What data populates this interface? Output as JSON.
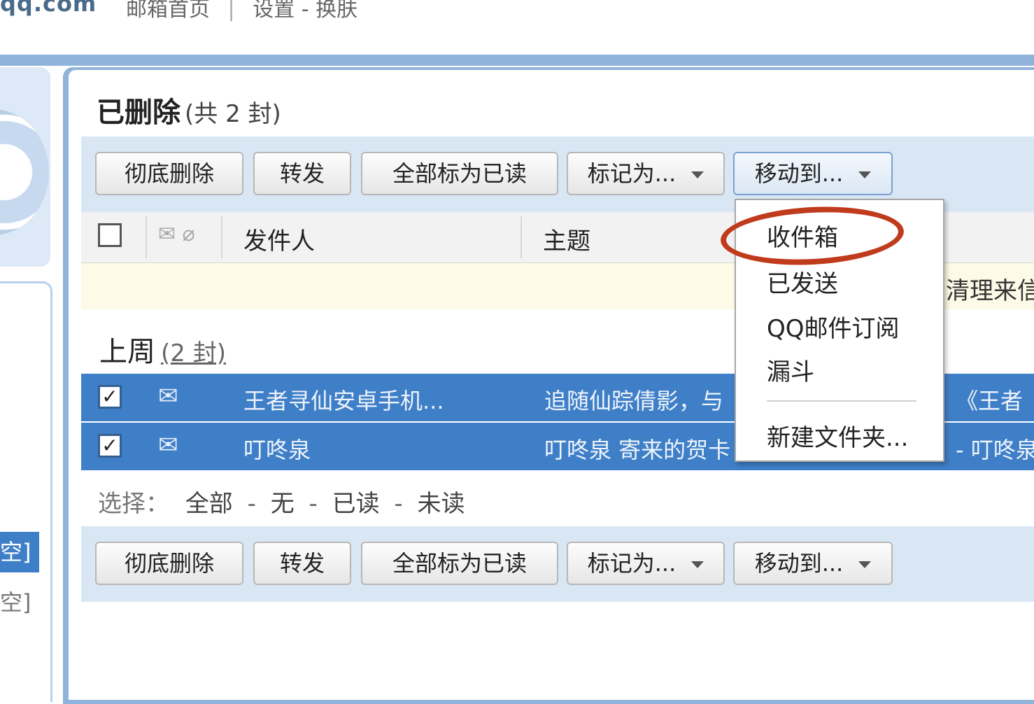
{
  "header": {
    "brand": "qq.com",
    "home_link": "邮箱首页",
    "separator": "|",
    "settings_link": "设置 - 换肤"
  },
  "sidebar": {
    "empty_label_1": "空]",
    "empty_label_2": "空]"
  },
  "folder": {
    "title": "已删除",
    "count": "(共 2 封)"
  },
  "toolbar": {
    "delete_forever": "彻底删除",
    "forward": "转发",
    "mark_all_read": "全部标为已读",
    "mark_as": "标记为...",
    "move_to": "移动到..."
  },
  "list_header": {
    "sender": "发件人",
    "subject": "主题"
  },
  "notice": {
    "text": "清理来信"
  },
  "group": {
    "title": "上周",
    "count": "(2 封)"
  },
  "mails": [
    {
      "sender": "王者寻仙安卓手机...",
      "subject": "追随仙踪倩影，与",
      "extra": "《王者",
      "checked": true
    },
    {
      "sender": "叮咚泉",
      "subject": "叮咚泉 寄来的贺卡",
      "extra": "- 叮咚泉",
      "checked": true
    }
  ],
  "select_bar": {
    "label": "选择：",
    "all": "全部",
    "none": "无",
    "read": "已读",
    "unread": "未读",
    "dash": "-"
  },
  "move_menu": {
    "items": [
      "收件箱",
      "已发送",
      "QQ邮件订阅",
      "漏斗"
    ],
    "new_folder": "新建文件夹..."
  },
  "colors": {
    "accent_blue": "#3f7fc8",
    "frame_blue": "#8fb3db",
    "toolbar_bg": "#d9e7f5",
    "highlight_ring": "#c03a1c"
  }
}
